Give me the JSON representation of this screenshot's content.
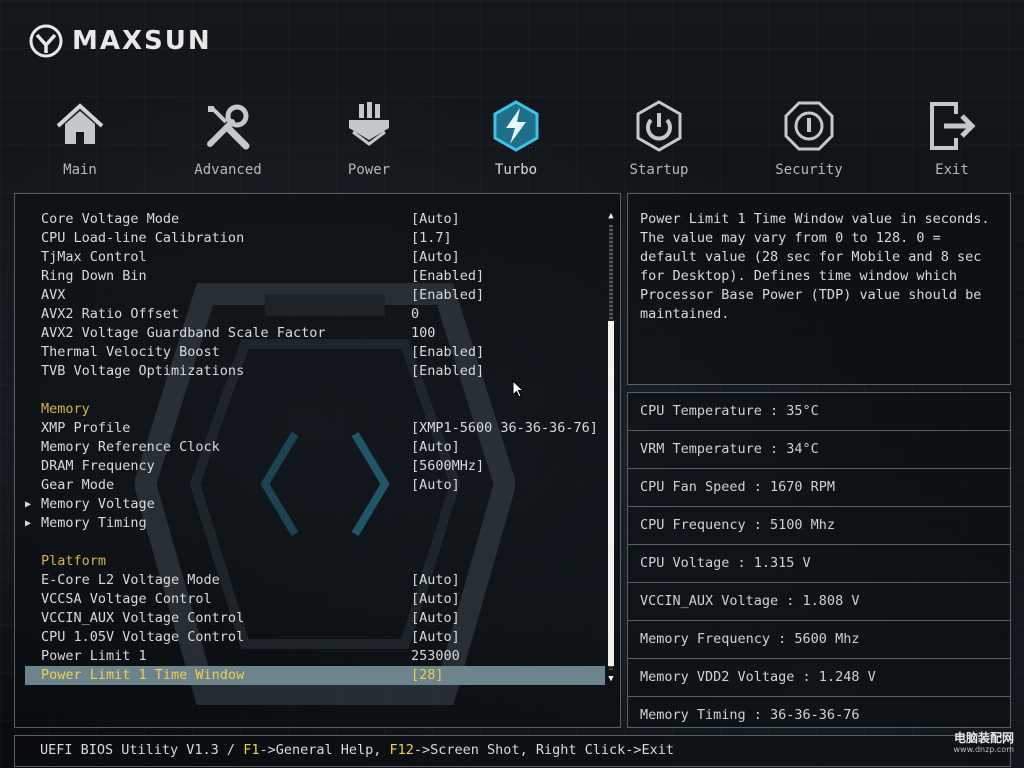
{
  "brand": {
    "name": "MAXSUN"
  },
  "nav": [
    {
      "label": "Main",
      "icon": "home-icon",
      "active": false
    },
    {
      "label": "Advanced",
      "icon": "tools-icon",
      "active": false
    },
    {
      "label": "Power",
      "icon": "power-plug-icon",
      "active": false
    },
    {
      "label": "Turbo",
      "icon": "turbo-lightning-icon",
      "active": true
    },
    {
      "label": "Startup",
      "icon": "power-button-icon",
      "active": false
    },
    {
      "label": "Security",
      "icon": "shield-icon",
      "active": false
    },
    {
      "label": "Exit",
      "icon": "exit-door-icon",
      "active": false
    }
  ],
  "settings": [
    {
      "label": "Core Voltage Mode",
      "value": "[Auto]"
    },
    {
      "label": "CPU Load-line Calibration",
      "value": "[1.7]"
    },
    {
      "label": "TjMax Control",
      "value": "[Auto]"
    },
    {
      "label": "Ring Down Bin",
      "value": "[Enabled]"
    },
    {
      "label": "AVX",
      "value": "[Enabled]"
    },
    {
      "label": "AVX2 Ratio Offset",
      "value": "0"
    },
    {
      "label": "AVX2 Voltage Guardband Scale Factor",
      "value": "100"
    },
    {
      "label": "Thermal Velocity Boost",
      "value": "[Enabled]"
    },
    {
      "label": "TVB Voltage Optimizations",
      "value": "[Enabled]"
    },
    {
      "label": "",
      "value": ""
    },
    {
      "label": "Memory",
      "value": ""
    },
    {
      "label": "XMP Profile",
      "value": "[XMP1-5600 36-36-36-76]"
    },
    {
      "label": "Memory Reference Clock",
      "value": "[Auto]"
    },
    {
      "label": "DRAM Frequency",
      "value": "[5600MHz]"
    },
    {
      "label": "Gear Mode",
      "value": "[Auto]"
    },
    {
      "label": "Memory Voltage",
      "value": ""
    },
    {
      "label": "Memory Timing",
      "value": ""
    },
    {
      "label": "",
      "value": ""
    },
    {
      "label": "Platform",
      "value": ""
    },
    {
      "label": "E-Core L2 Voltage Mode",
      "value": "[Auto]"
    },
    {
      "label": "VCCSA Voltage Control",
      "value": "[Auto]"
    },
    {
      "label": "VCCIN_AUX Voltage Control",
      "value": "[Auto]"
    },
    {
      "label": "CPU 1.05V Voltage Control",
      "value": "[Auto]"
    },
    {
      "label": "Power Limit 1",
      "value": "253000"
    },
    {
      "label": "Power Limit 1 Time Window",
      "value": "[28]"
    }
  ],
  "help_text": "Power Limit 1 Time Window value in seconds.\nThe value may vary from 0 to 128. 0 =\ndefault value (28 sec for Mobile and 8 sec\nfor Desktop). Defines time window which\nProcessor Base Power (TDP) value should be\nmaintained.",
  "status": [
    "CPU Temperature : 35°C",
    "VRM Temperature : 34°C",
    "CPU Fan Speed : 1670 RPM",
    "CPU Frequency : 5100 Mhz",
    "CPU Voltage : 1.315 V",
    "VCCIN_AUX Voltage : 1.808 V",
    "Memory Frequency : 5600 Mhz",
    "Memory VDD2 Voltage : 1.248 V",
    "Memory Timing : 36-36-36-76"
  ],
  "footer": {
    "prefix": "UEFI BIOS Utility V1.3 / ",
    "key1": "F1",
    "text1": "->General Help, ",
    "key2": "F12",
    "text2": "->Screen Shot, Right Click->Exit"
  },
  "watermark": {
    "cn": "电脑装配网",
    "url": "www.dnzp.com"
  },
  "colors": {
    "accent": "#f0cf4f",
    "header": "#d6b04a",
    "selected_bg": "#6d848c",
    "turbo": "#27a3c8"
  }
}
